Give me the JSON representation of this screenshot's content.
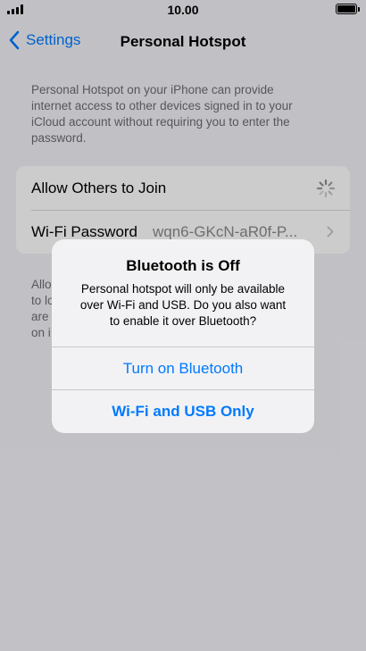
{
  "status_bar": {
    "time": "10.00",
    "signal_icon": "cellular-signal-icon",
    "battery_icon": "battery-full-icon"
  },
  "nav": {
    "back_label": "Settings",
    "title": "Personal Hotspot"
  },
  "description_lines": [
    "Personal Hotspot on your iPhone can provide",
    "internet access to other devices signed in to your",
    "iCloud account without requiring you to enter the",
    "password."
  ],
  "settings": {
    "allow_others_label": "Allow Others to Join",
    "allow_others_state_icon": "loading-spinner-icon",
    "wifi_password_label": "Wi-Fi Password",
    "wifi_password_value": "wqn6-GKcN-aR0f-P..."
  },
  "footer_lines": [
    "Allo",
    "to lo",
    "are",
    "on i"
  ],
  "alert": {
    "title": "Bluetooth is Off",
    "message_lines": [
      "Personal hotspot will only be available",
      "over Wi-Fi and USB. Do you also want",
      "to enable it over Bluetooth?"
    ],
    "primary_button": "Turn on Bluetooth",
    "secondary_button": "Wi-Fi and USB Only"
  },
  "colors": {
    "accent": "#007aff",
    "background": "#f2f2f7",
    "secondary_text": "#6d6d72"
  }
}
